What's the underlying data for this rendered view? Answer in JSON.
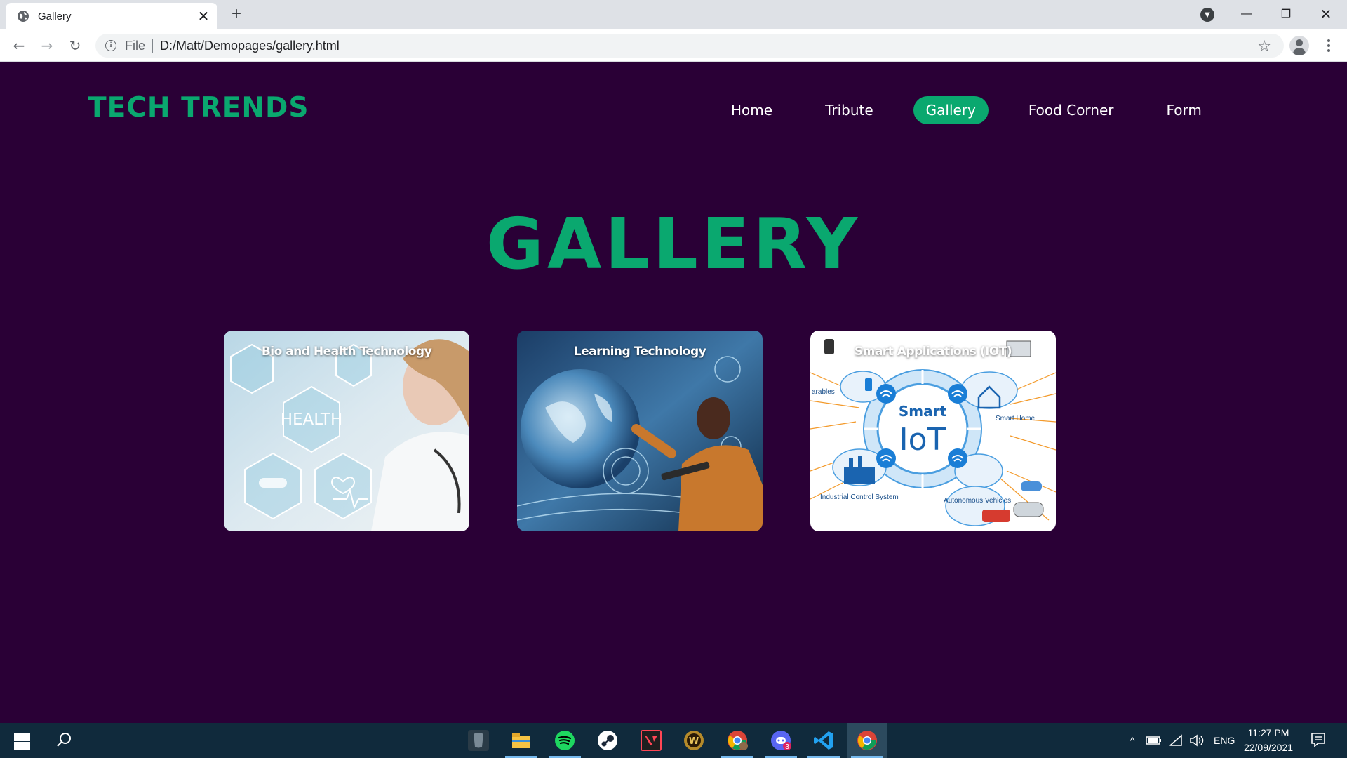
{
  "browser": {
    "tab_title": "Gallery",
    "tab_close": "✕",
    "new_tab": "+",
    "omnibox_scheme": "File",
    "omnibox_url": "D:/Matt/Demopages/gallery.html",
    "window_controls": {
      "minimize": "—",
      "restore": "❐",
      "close": "✕"
    }
  },
  "site": {
    "brand": "TECH TRENDS",
    "nav": [
      {
        "label": "Home",
        "active": false
      },
      {
        "label": "Tribute",
        "active": false
      },
      {
        "label": "Gallery",
        "active": true
      },
      {
        "label": "Food Corner",
        "active": false
      },
      {
        "label": "Form",
        "active": false
      }
    ],
    "page_title": "GALLERY",
    "gallery": [
      {
        "caption": "Bio and Health Technology",
        "image_text": "HEALTH"
      },
      {
        "caption": "Learning Technology"
      },
      {
        "caption": "Smart Applications (IOT)",
        "image_text_top": "Smart",
        "image_text_main": "IoT",
        "labels": [
          "arables",
          "Smart Home",
          "Industrial Control System",
          "Autonomous Vehicles"
        ]
      }
    ],
    "colors": {
      "background": "#2a0036",
      "accent": "#0aa86f",
      "nav_text": "#ffffff"
    }
  },
  "taskbar": {
    "apps": [
      "alienware-icon",
      "file-explorer-icon",
      "spotify-icon",
      "steam-icon",
      "valorant-icon",
      "world-of-warcraft-icon",
      "chrome-profile-icon",
      "discord-icon",
      "vscode-icon",
      "chrome-icon"
    ],
    "discord_badge": "3",
    "language": "ENG",
    "time": "11:27 PM",
    "date": "22/09/2021"
  }
}
